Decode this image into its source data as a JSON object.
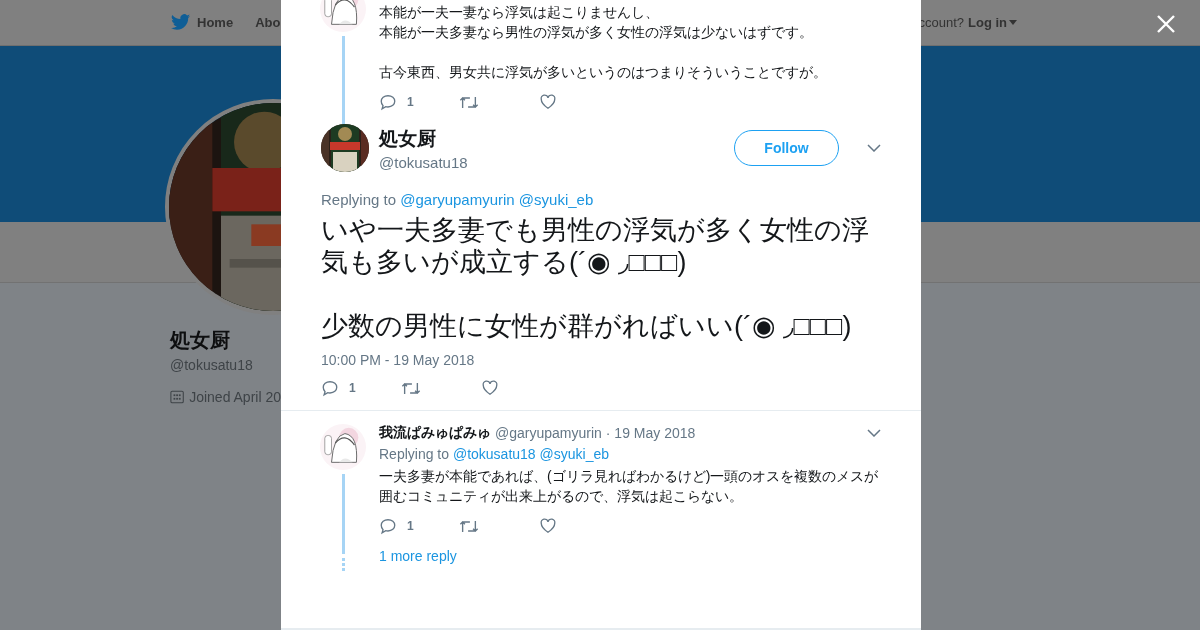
{
  "nav": {
    "items": [
      {
        "label": "Home",
        "kind": "home"
      },
      {
        "label": "Abo",
        "kind": "plain"
      }
    ],
    "account_prompt": "ccount?",
    "login": "Log in"
  },
  "profile": {
    "name": "処女厨",
    "handle": "@tokusatu18",
    "joined": "Joined April 20"
  },
  "thread": {
    "parent": {
      "paragraphs": [
        [
          "本能が一夫一妻なら浮気は起こりませんし、",
          "本能が一夫多妻なら男性の浮気が多く女性の浮気は少ないはずです。"
        ],
        [
          "古今東西、男女共に浮気が多いというのはつまりそういうことですが。"
        ]
      ],
      "reply_count": "1"
    },
    "main": {
      "name": "処女厨",
      "handle": "@tokusatu18",
      "follow": "Follow",
      "replying_label": "Replying to",
      "replying_to": [
        "@garyupamyurin",
        "@syuki_eb"
      ],
      "text": "いや一夫多妻でも男性の浮気が多く女性の浮気も多いが成立する(´◉ ◞□□□)\n\n少数の男性に女性が群がればいい(´◉ ◞□□□)",
      "time": "10:00 PM - 19 May 2018",
      "reply_count": "1"
    },
    "replies": [
      {
        "name": "我流ぱみゅぱみゅ",
        "handle": "@garyupamyurin",
        "date": "· 19 May 2018",
        "replying_label": "Replying to",
        "replying_to": [
          "@tokusatu18",
          "@syuki_eb"
        ],
        "lines": [
          "一夫多妻が本能であれば、(ゴリラ見ればわかるけど)一頭のオスを複数のメスが",
          "囲むコミュニティが出来上がるので、浮気は起こらない。"
        ],
        "reply_count": "1",
        "more": "1 more reply"
      }
    ]
  }
}
